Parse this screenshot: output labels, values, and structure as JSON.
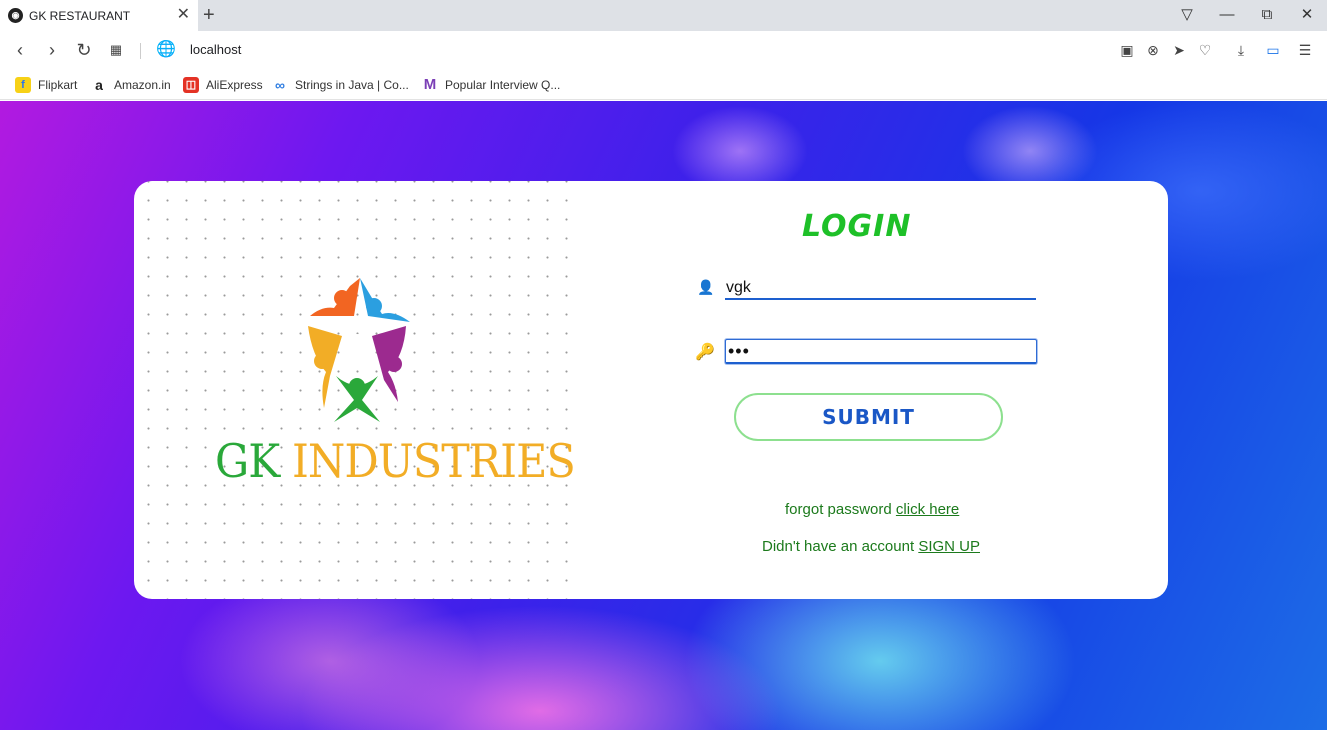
{
  "browser": {
    "tab_title": "GK RESTAURANT",
    "url": "localhost",
    "bookmarks": [
      {
        "label": "Flipkart",
        "icon": "flipkart-icon",
        "color": "#f7d117"
      },
      {
        "label": "Amazon.in",
        "icon": "amazon-icon",
        "color": "#222222"
      },
      {
        "label": "AliExpress",
        "icon": "aliexpress-icon",
        "color": "#e43225"
      },
      {
        "label": "Strings in Java | Co...",
        "icon": "infinity-icon",
        "color": "#2f7de1"
      },
      {
        "label": "Popular Interview Q...",
        "icon": "m-logo-icon",
        "color": "#7b3fb6"
      }
    ]
  },
  "brand": {
    "name_part1": "GK",
    "name_part2": "INDUSTRIES",
    "colors": {
      "green": "#2aa83a",
      "gold": "#f2ad26",
      "orange": "#f26522",
      "blue": "#2b9fe0",
      "purple": "#9c2a8f"
    }
  },
  "login": {
    "title": "LOGIN",
    "username_value": "vgk",
    "password_masked": "•••",
    "submit_label": "SUBMIT",
    "forgot_text": "forgot password",
    "forgot_link": "click here",
    "signup_text": "Didn't have an account",
    "signup_link": "SIGN UP"
  },
  "colors": {
    "title_green": "#1ec028",
    "button_text": "#1a57c6",
    "button_border": "#8de08f",
    "link_green": "#1c7a1c",
    "input_line": "#1d5fcf"
  }
}
